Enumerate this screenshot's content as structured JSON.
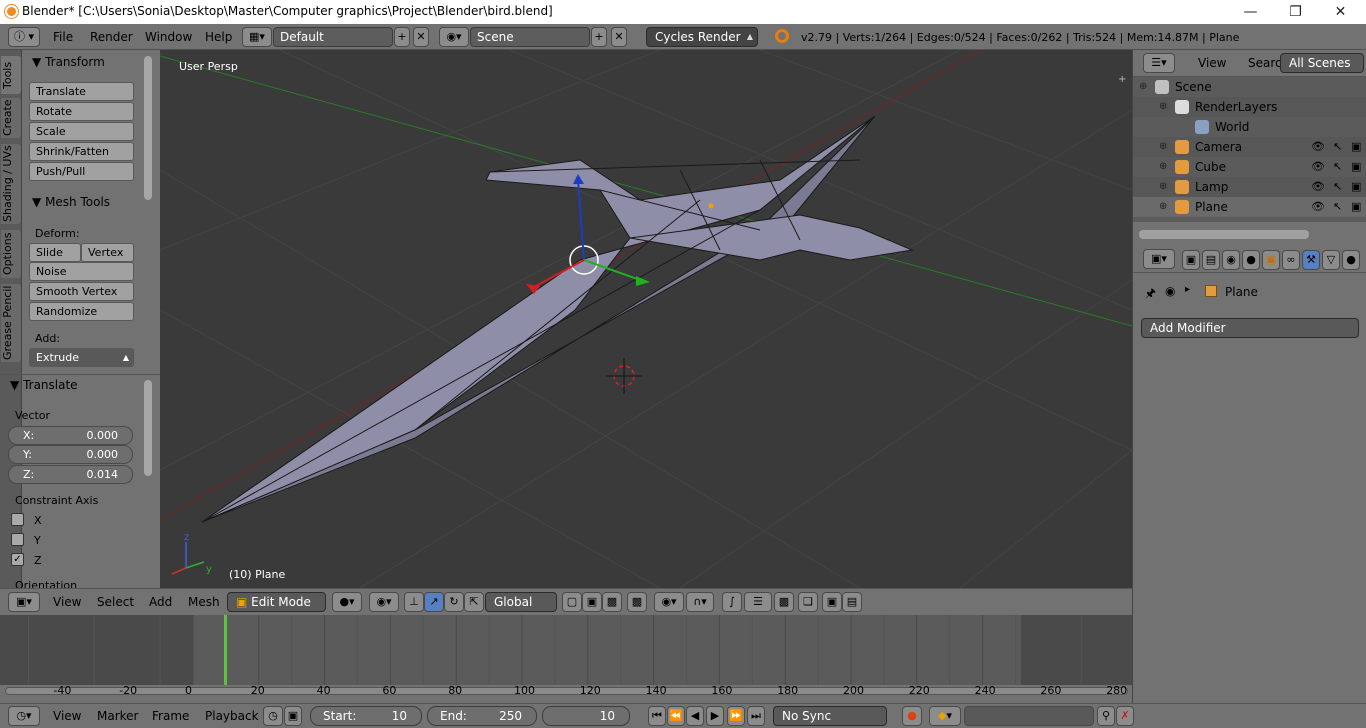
{
  "window": {
    "title": "Blender* [C:\\Users\\Sonia\\Desktop\\Master\\Computer graphics\\Project\\Blender\\bird.blend]"
  },
  "infobar": {
    "menus": [
      "File",
      "Render",
      "Window",
      "Help"
    ],
    "layout": "Default",
    "scene": "Scene",
    "engine": "Cycles Render",
    "stats": "v2.79 | Verts:1/264 | Edges:0/524 | Faces:0/262 | Tris:524 | Mem:14.87M | Plane"
  },
  "tabs": [
    "Tools",
    "Create",
    "Shading / UVs",
    "Options",
    "Grease Pencil"
  ],
  "toolshelf": {
    "transform_title": "Transform",
    "transform_buttons": [
      "Translate",
      "Rotate",
      "Scale",
      "Shrink/Fatten",
      "Push/Pull"
    ],
    "meshtools_title": "Mesh Tools",
    "deform_label": "Deform:",
    "slide_ed": "Slide Ed",
    "vertex": "Vertex",
    "deform_buttons": [
      "Noise",
      "Smooth Vertex",
      "Randomize"
    ],
    "add_label": "Add:",
    "extrude": "Extrude",
    "op_title": "Translate",
    "vector_label": "Vector",
    "vector": [
      {
        "k": "X:",
        "v": "0.000"
      },
      {
        "k": "Y:",
        "v": "0.000"
      },
      {
        "k": "Z:",
        "v": "0.014"
      }
    ],
    "constraint_label": "Constraint Axis",
    "axes": [
      {
        "name": "X",
        "checked": false
      },
      {
        "name": "Y",
        "checked": false
      },
      {
        "name": "Z",
        "checked": true
      }
    ],
    "orientation_label": "Orientation"
  },
  "viewport": {
    "view_name": "User Persp",
    "object_label": "(10) Plane"
  },
  "vheader": {
    "menus": [
      "View",
      "Select",
      "Add",
      "Mesh"
    ],
    "mode": "Edit Mode",
    "orientation": "Global"
  },
  "timeline": {
    "ticks": [
      "-40",
      "-20",
      "0",
      "20",
      "40",
      "60",
      "80",
      "100",
      "120",
      "140",
      "160",
      "180",
      "200",
      "220",
      "240",
      "260",
      "280"
    ],
    "current_frame": 10
  },
  "tlheader": {
    "menus": [
      "View",
      "Marker",
      "Frame",
      "Playback"
    ],
    "start_label": "Start:",
    "start": "10",
    "end_label": "End:",
    "end": "250",
    "current": "10",
    "sync": "No Sync"
  },
  "outliner": {
    "tabs": [
      "View",
      "Search",
      "All Scenes"
    ],
    "items": [
      {
        "label": "Scene",
        "icon": "scene-icon"
      },
      {
        "label": "RenderLayers",
        "icon": "renderlayers-icon"
      },
      {
        "label": "World",
        "icon": "world-icon"
      },
      {
        "label": "Camera",
        "icon": "camera-icon"
      },
      {
        "label": "Cube",
        "icon": "mesh-icon"
      },
      {
        "label": "Lamp",
        "icon": "lamp-icon"
      },
      {
        "label": "Plane",
        "icon": "mesh-icon"
      }
    ]
  },
  "properties": {
    "object": "Plane",
    "add_modifier": "Add Modifier"
  },
  "colors": {
    "accent": "#5680c2",
    "timeline_frame": "#60c040",
    "x_axis": "#a02020",
    "y_axis": "#30a030"
  }
}
